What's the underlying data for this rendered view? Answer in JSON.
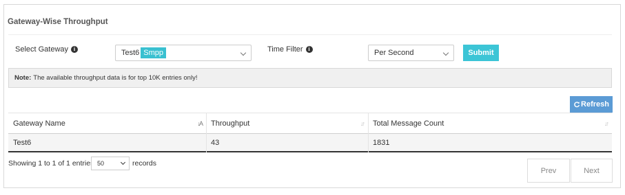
{
  "header": {
    "title": "Gateway-Wise Throughput"
  },
  "filters": {
    "gateway_label": "Select Gateway",
    "gateway_value": "Test6",
    "gateway_tag": "Smpp",
    "time_label": "Time Filter",
    "time_value": "Per Second",
    "submit_label": "Submit"
  },
  "note": {
    "prefix": "Note:",
    "text": "The available throughput data is for top 10K entries only!"
  },
  "refresh_label": "Refresh",
  "table": {
    "columns": [
      "Gateway Name",
      "Throughput",
      "Total Message Count"
    ],
    "rows": [
      [
        "Test6",
        "43",
        "1831"
      ]
    ]
  },
  "footer": {
    "showing_text": "Showing 1 to 1 of 1 entries",
    "page_size": "50",
    "records_label": "records",
    "prev_label": "Prev",
    "next_label": "Next"
  },
  "colors": {
    "accent": "#3cc5d6",
    "refresh": "#5b9bd5",
    "note_bg": "#f0f0f0"
  }
}
